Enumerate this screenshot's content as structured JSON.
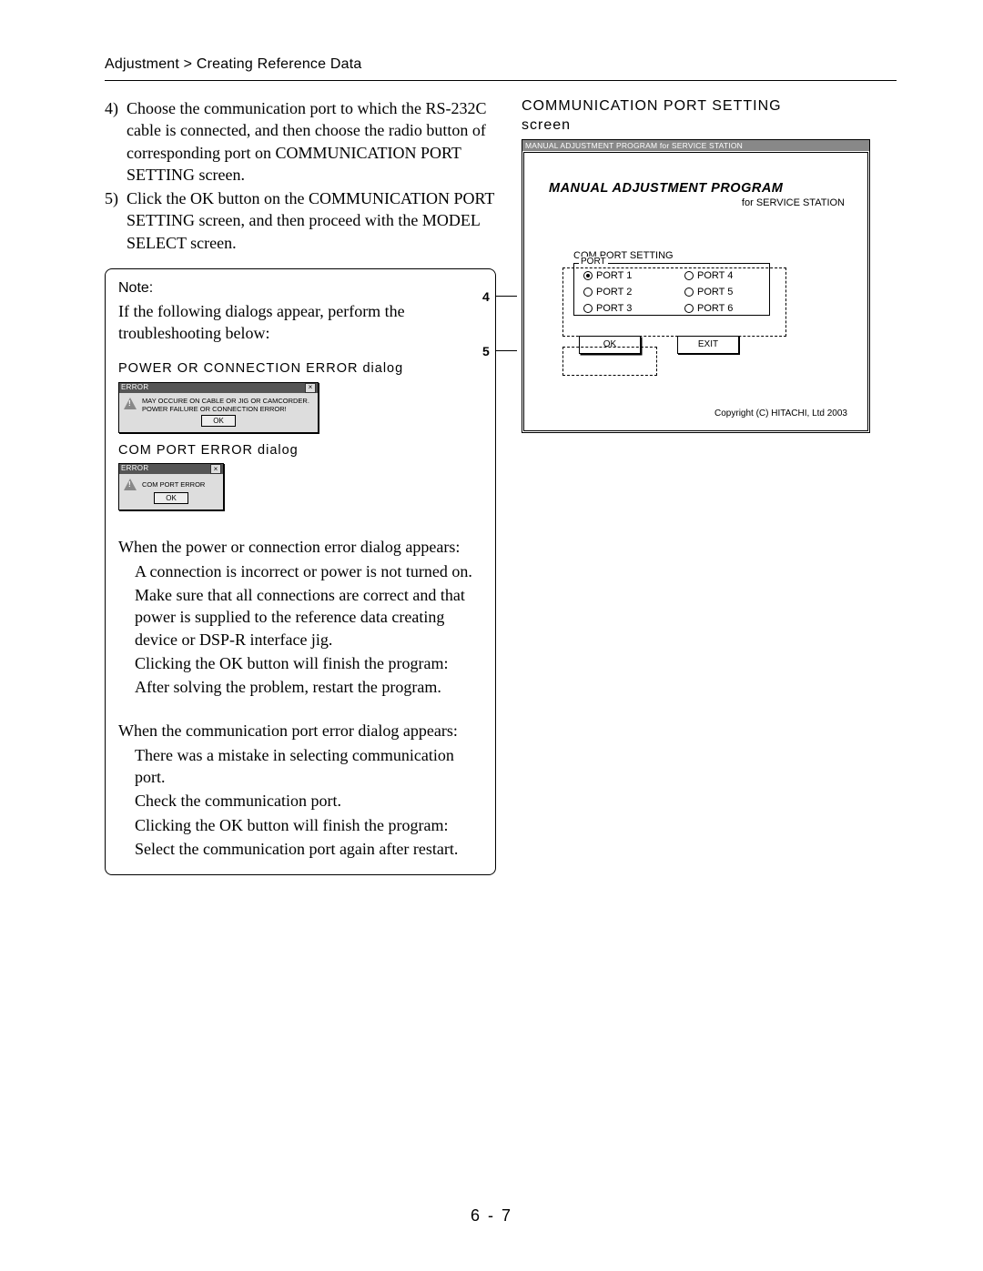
{
  "breadcrumb": "Adjustment > Creating Reference Data",
  "steps": [
    {
      "num": "4)",
      "text": "Choose the communication port to which the RS-232C cable is connected, and then choose the radio button of corresponding port on COMMUNICATION PORT SETTING screen."
    },
    {
      "num": "5)",
      "text": "Click the OK button on the COMMUNICATION PORT SETTING screen, and then proceed with the MODEL SELECT screen."
    }
  ],
  "note": {
    "label": "Note:",
    "intro": "If the following dialogs appear, perform the troubleshooting below:",
    "dlg1_label": "POWER  OR  CONNECTION  ERROR  dialog",
    "dlg2_label": "COM  PORT  ERROR  dialog",
    "dlg1": {
      "title": "ERROR",
      "msg1": "MAY OCCURE ON CABLE OR JIG OR CAMCORDER.",
      "msg2": "POWER FAILURE OR CONNECTION ERROR!",
      "ok": "OK"
    },
    "dlg2": {
      "title": "ERROR",
      "msg": "COM PORT ERROR",
      "ok": "OK"
    },
    "tb1_head": "When the power or connection error dialog appears:",
    "tb1_l1": "A connection is incorrect or power is not turned on.",
    "tb1_l2": "Make sure that all connections are correct and that power is supplied to the reference data creating device or DSP-R interface jig.",
    "tb1_l3": "Clicking the OK button will finish the program:",
    "tb1_l4": "After solving the problem, restart the program.",
    "tb2_head": "When the communication port error dialog appears:",
    "tb2_l1": "There was a mistake in selecting communication port.",
    "tb2_l2": "Check the communication port.",
    "tb2_l3": "Clicking the OK button will finish the program:",
    "tb2_l4": "Select the communication port again after restart."
  },
  "right": {
    "screen_label_1": "COMMUNICATION  PORT  SETTING",
    "screen_label_2": "screen",
    "app_title": "MANUAL ADJUSTMENT PROGRAM for SERVICE STATION",
    "heading": "MANUAL ADJUSTMENT PROGRAM",
    "sub": "for SERVICE STATION",
    "comport_label": "COM PORT SETTING",
    "port_legend": "PORT",
    "ports": [
      "PORT 1",
      "PORT 2",
      "PORT 3",
      "PORT 4",
      "PORT 5",
      "PORT 6"
    ],
    "selected_port_index": 0,
    "ok": "OK",
    "exit": "EXIT",
    "copyright": "Copyright (C) HITACHI, Ltd  2003",
    "callout4": "4",
    "callout5": "5"
  },
  "page_number": "6  -  7"
}
